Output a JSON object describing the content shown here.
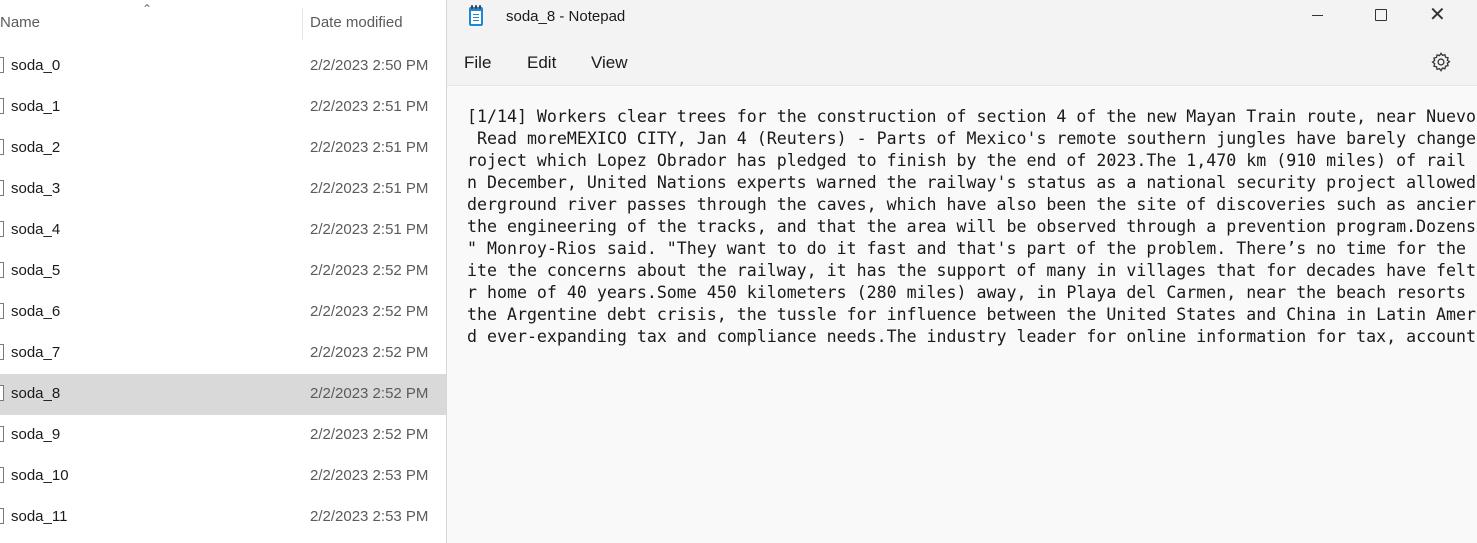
{
  "explorer": {
    "columns": {
      "name": "Name",
      "date_modified": "Date modified"
    },
    "files": [
      {
        "name": "soda_0",
        "date": "2/2/2023 2:50 PM"
      },
      {
        "name": "soda_1",
        "date": "2/2/2023 2:51 PM"
      },
      {
        "name": "soda_2",
        "date": "2/2/2023 2:51 PM"
      },
      {
        "name": "soda_3",
        "date": "2/2/2023 2:51 PM"
      },
      {
        "name": "soda_4",
        "date": "2/2/2023 2:51 PM"
      },
      {
        "name": "soda_5",
        "date": "2/2/2023 2:52 PM"
      },
      {
        "name": "soda_6",
        "date": "2/2/2023 2:52 PM"
      },
      {
        "name": "soda_7",
        "date": "2/2/2023 2:52 PM"
      },
      {
        "name": "soda_8",
        "date": "2/2/2023 2:52 PM",
        "selected": true
      },
      {
        "name": "soda_9",
        "date": "2/2/2023 2:52 PM"
      },
      {
        "name": "soda_10",
        "date": "2/2/2023 2:53 PM"
      },
      {
        "name": "soda_11",
        "date": "2/2/2023 2:53 PM"
      }
    ]
  },
  "notepad": {
    "title": "soda_8 - Notepad",
    "menu": {
      "file": "File",
      "edit": "Edit",
      "view": "View"
    },
    "icons": {
      "app": "notepad-icon",
      "settings": "gear-icon",
      "minimize": "minimize-icon",
      "maximize": "maximize-icon",
      "close": "close-icon"
    },
    "content_lines": [
      "[1/14] Workers clear trees for the construction of section 4 of the new Mayan Train route, near Nuevo",
      " Read moreMEXICO CITY, Jan 4 (Reuters) - Parts of Mexico's remote southern jungles have barely change",
      "roject which Lopez Obrador has pledged to finish by the end of 2023.The 1,470 km (910 miles) of rail",
      "n December, United Nations experts warned the railway's status as a national security project allowed",
      "derground river passes through the caves, which have also been the site of discoveries such as ancier",
      "the engineering of the tracks, and that the area will be observed through a prevention program.Dozens",
      "\" Monroy-Rios said. \"They want to do it fast and that's part of the problem. There’s no time for the",
      "ite the concerns about the railway, it has the support of many in villages that for decades have felt",
      "r home of 40 years.Some 450 kilometers (280 miles) away, in Playa del Carmen, near the beach resorts",
      "the Argentine debt crisis, the tussle for influence between the United States and China in Latin Amer",
      "d ever-expanding tax and compliance needs.The industry leader for online information for tax, account"
    ]
  }
}
